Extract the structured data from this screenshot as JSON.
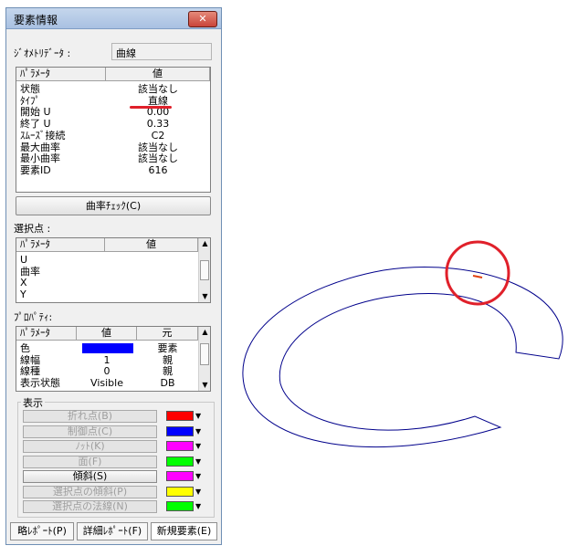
{
  "window": {
    "title": "要素情報",
    "close_label": "✕"
  },
  "geometry": {
    "label": "ｼﾞｵﾒﾄﾘﾃﾞｰﾀ :",
    "value": "曲線"
  },
  "params_table": {
    "headers": [
      "ﾊﾟﾗﾒｰﾀ",
      "値"
    ],
    "rows": [
      [
        "状態",
        "該当なし"
      ],
      [
        "ﾀｲﾌﾟ",
        "直線"
      ],
      [
        "開始 U",
        "0.00"
      ],
      [
        "終了 U",
        "0.33"
      ],
      [
        "ｽﾑｰｽﾞ接続",
        "C2"
      ],
      [
        "最大曲率",
        "該当なし"
      ],
      [
        "最小曲率",
        "該当なし"
      ],
      [
        "要素ID",
        "616"
      ]
    ]
  },
  "curvature_check_label": "曲率ﾁｪｯｸ(C)",
  "selected_point": {
    "label": "選択点 :",
    "headers": [
      "ﾊﾟﾗﾒｰﾀ",
      "値"
    ],
    "rows": [
      "U",
      "曲率",
      "X",
      "Y"
    ]
  },
  "property": {
    "label": "ﾌﾟﾛﾊﾟﾃｨ:",
    "headers": [
      "ﾊﾟﾗﾒｰﾀ",
      "値",
      "元"
    ],
    "rows": [
      [
        "色",
        "",
        "要素"
      ],
      [
        "線幅",
        "1",
        "親"
      ],
      [
        "線種",
        "0",
        "親"
      ],
      [
        "表示状態",
        "Visible",
        "DB"
      ]
    ]
  },
  "display": {
    "label": "表示",
    "items": [
      {
        "label": "折れ点(B)",
        "color": "#ff0000",
        "enabled": false
      },
      {
        "label": "制御点(C)",
        "color": "#0000ff",
        "enabled": false
      },
      {
        "label": "ﾉｯﾄ(K)",
        "color": "#ff00ff",
        "enabled": false
      },
      {
        "label": "面(F)",
        "color": "#00ff00",
        "enabled": false
      },
      {
        "label": "傾斜(S)",
        "color": "#ff00ff",
        "enabled": true
      },
      {
        "label": "選択点の傾斜(P)",
        "color": "#ffff00",
        "enabled": false
      },
      {
        "label": "選択点の法線(N)",
        "color": "#00ff00",
        "enabled": false
      }
    ]
  },
  "tabs": [
    "略ﾚﾎﾟｰﾄ(P)",
    "詳細ﾚﾎﾟｰﾄ(F)",
    "新規要素(E)"
  ],
  "colors": {
    "curve": "#00008b",
    "annotation": "#e0202a",
    "highlight": "#e04010",
    "property_color": "#0000ff"
  }
}
